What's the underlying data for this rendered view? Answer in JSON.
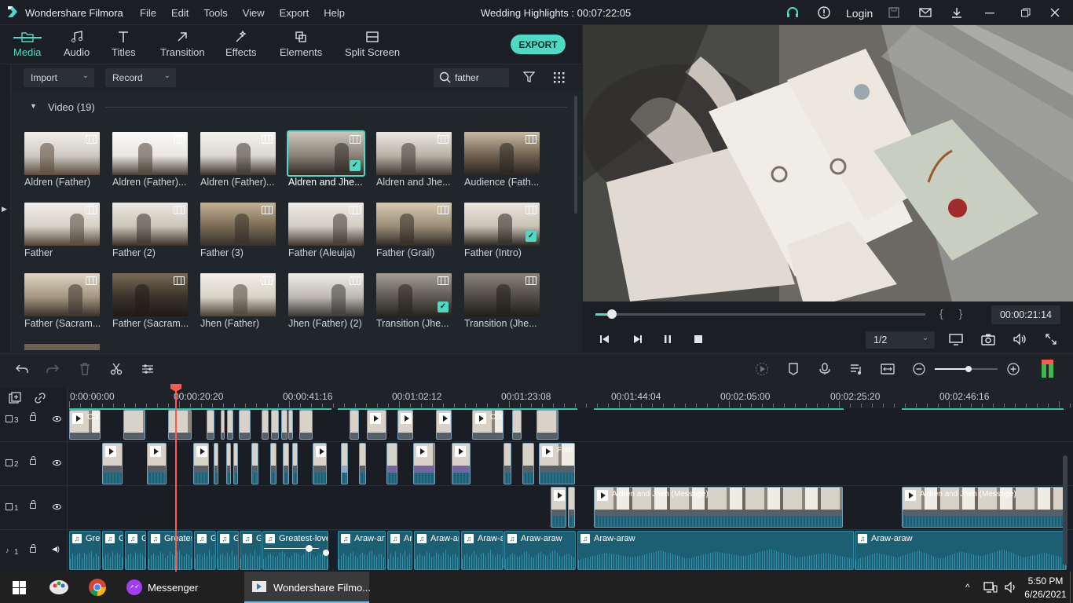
{
  "app": {
    "name": "Wondershare Filmora",
    "project_title": "Wedding Highlights : 00:07:22:05",
    "login": "Login"
  },
  "menu": [
    "File",
    "Edit",
    "Tools",
    "View",
    "Export",
    "Help"
  ],
  "tabs": [
    "Media",
    "Audio",
    "Titles",
    "Transition",
    "Effects",
    "Elements",
    "Split Screen"
  ],
  "active_tab": "Media",
  "export_label": "EXPORT",
  "toolbar": {
    "import": "Import",
    "record": "Record",
    "search_value": "father"
  },
  "library": {
    "section": "Video (19)",
    "items": [
      {
        "label": "Aldren (Father)",
        "checked": false,
        "selected": false
      },
      {
        "label": "Aldren (Father)...",
        "checked": false,
        "selected": false
      },
      {
        "label": "Aldren (Father)...",
        "checked": false,
        "selected": false
      },
      {
        "label": "Aldren and Jhe...",
        "checked": true,
        "selected": true
      },
      {
        "label": "Aldren and Jhe...",
        "checked": false,
        "selected": false
      },
      {
        "label": "Audience (Fath...",
        "checked": false,
        "selected": false
      },
      {
        "label": "Father",
        "checked": false,
        "selected": false
      },
      {
        "label": "Father (2)",
        "checked": false,
        "selected": false
      },
      {
        "label": "Father (3)",
        "checked": false,
        "selected": false
      },
      {
        "label": "Father (Aleuija)",
        "checked": false,
        "selected": false
      },
      {
        "label": "Father (Grail)",
        "checked": false,
        "selected": false
      },
      {
        "label": "Father (Intro)",
        "checked": true,
        "selected": false
      },
      {
        "label": "Father (Sacram...",
        "checked": false,
        "selected": false
      },
      {
        "label": "Father (Sacram...",
        "checked": false,
        "selected": false
      },
      {
        "label": "Jhen (Father)",
        "checked": false,
        "selected": false
      },
      {
        "label": "Jhen (Father) (2)",
        "checked": false,
        "selected": false
      },
      {
        "label": "Transition (Jhe...",
        "checked": true,
        "selected": false
      },
      {
        "label": "Transition (Jhe...",
        "checked": false,
        "selected": false
      }
    ]
  },
  "player": {
    "current_time": "00:00:21:14",
    "ratio": "1/2",
    "progress": 0.05
  },
  "ruler": [
    "0:00:00:00",
    "00:00:20:20",
    "00:00:41:16",
    "00:01:02:12",
    "00:01:23:08",
    "00:01:44:04",
    "00:02:05:00",
    "00:02:25:20",
    "00:02:46:16"
  ],
  "tracks": {
    "v3": {
      "num": "3",
      "clips": [
        "C00",
        "C00"
      ]
    },
    "v2": {
      "num": "2",
      "clips": [
        "Fath"
      ]
    },
    "v1": {
      "num": "1",
      "clips": [
        "Aldren and Jhen (Message)",
        "Aldren and Jhen (Message)"
      ]
    },
    "a1": {
      "num": "1",
      "clips": [
        "Gre",
        "G",
        "G",
        "Greates",
        "G",
        "G",
        "G",
        "Greatest-love",
        "Araw-ara",
        "Ar",
        "Araw-ar",
        "Araw-a",
        "Araw-araw",
        "Araw-araw",
        "Araw-araw"
      ]
    }
  },
  "taskbar": {
    "apps": [
      "Messenger",
      "Wondershare Filmo..."
    ],
    "time": "5:50 PM",
    "date": "6/26/2021"
  }
}
